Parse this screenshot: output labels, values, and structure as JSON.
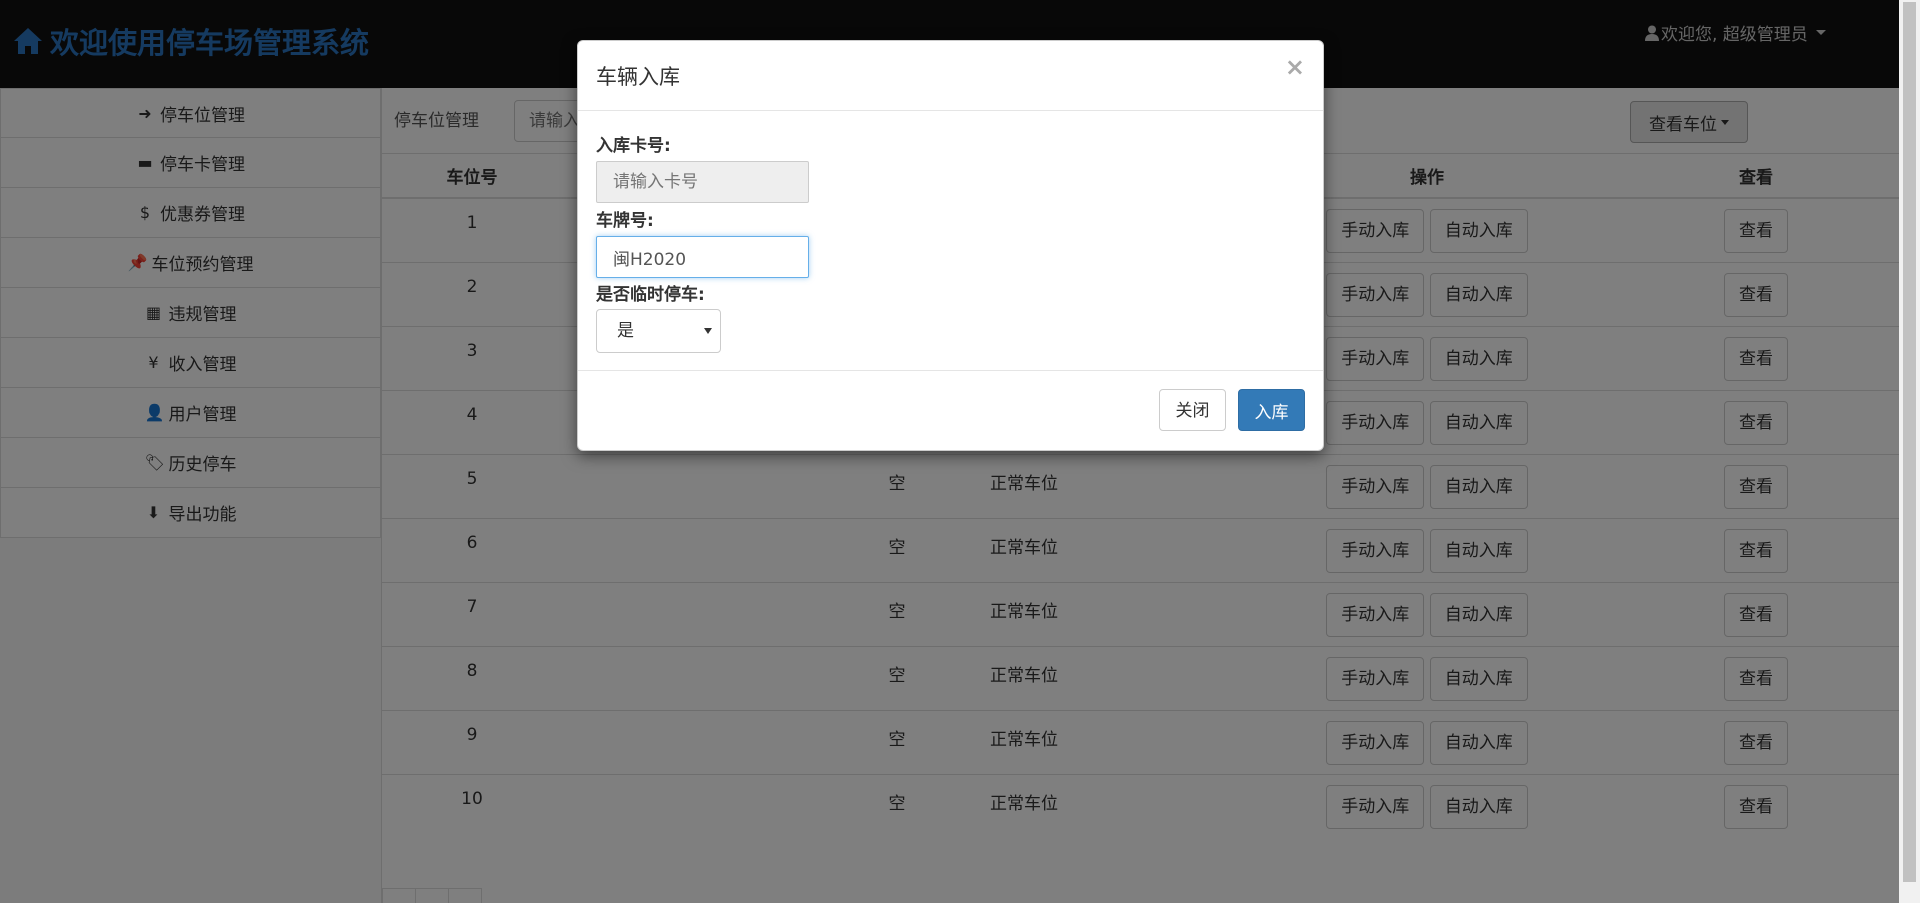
{
  "app": {
    "brand_title": "欢迎使用停车场管理系统",
    "user_label": "欢迎您, 超级管理员"
  },
  "sidebar": {
    "items": [
      {
        "label": "停车位管理",
        "icon": "sign-in-icon",
        "glyph": "➜"
      },
      {
        "label": "停车卡管理",
        "icon": "credit-card-icon",
        "glyph": "▬"
      },
      {
        "label": "优惠券管理",
        "icon": "dollar-icon",
        "glyph": "$"
      },
      {
        "label": "车位预约管理",
        "icon": "pushpin-icon",
        "glyph": "📌"
      },
      {
        "label": "违规管理",
        "icon": "grid-icon",
        "glyph": "▦"
      },
      {
        "label": "收入管理",
        "icon": "yen-icon",
        "glyph": "¥"
      },
      {
        "label": "用户管理",
        "icon": "user-icon",
        "glyph": "👤"
      },
      {
        "label": "历史停车",
        "icon": "tags-icon",
        "glyph": "🏷"
      },
      {
        "label": "导出功能",
        "icon": "download-circle-icon",
        "glyph": "⬇"
      }
    ]
  },
  "main": {
    "breadcrumb": "停车位管理",
    "search_placeholder": "请输入",
    "view_button_label": "查看车位",
    "table": {
      "headers": {
        "slot_no": "车位号",
        "ops": "操作",
        "view": "查看"
      },
      "manual_label": "手动入库",
      "auto_label": "自动入库",
      "view_label": "查看",
      "rows": [
        {
          "no": "1",
          "status": "",
          "type": ""
        },
        {
          "no": "2",
          "status": "",
          "type": ""
        },
        {
          "no": "3",
          "status": "",
          "type": ""
        },
        {
          "no": "4",
          "status": "",
          "type": ""
        },
        {
          "no": "5",
          "status": "空",
          "type": "正常车位"
        },
        {
          "no": "6",
          "status": "空",
          "type": "正常车位"
        },
        {
          "no": "7",
          "status": "空",
          "type": "正常车位"
        },
        {
          "no": "8",
          "status": "空",
          "type": "正常车位"
        },
        {
          "no": "9",
          "status": "空",
          "type": "正常车位"
        },
        {
          "no": "10",
          "status": "空",
          "type": "正常车位"
        }
      ]
    }
  },
  "modal": {
    "title": "车辆入库",
    "close_glyph": "×",
    "card_label": "入库卡号:",
    "card_placeholder": "请输入卡号",
    "plate_label": "车牌号:",
    "plate_value": "闽H2020",
    "temp_label": "是否临时停车:",
    "temp_value": "是",
    "close_button": "关闭",
    "submit_button": "入库"
  },
  "colors": {
    "brand": "#2a74c0",
    "primary": "#337ab7",
    "topbar": "#111111"
  }
}
